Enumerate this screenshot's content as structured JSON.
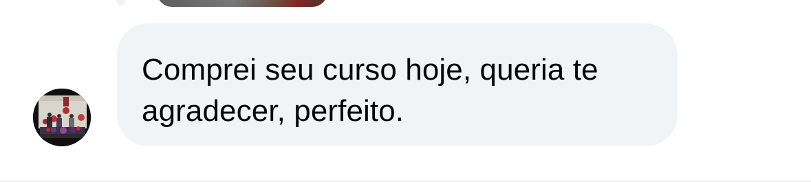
{
  "thread": {
    "previous_message": {
      "type": "image-attachment"
    },
    "incoming_message": {
      "sender_avatar_icon": "group-photo-avatar",
      "text": "Comprei seu curso hoje, queria te agradecer, perfeito."
    }
  },
  "colors": {
    "bubble_background": "#f2f3f5",
    "text": "#050505",
    "page_background": "#ffffff"
  }
}
